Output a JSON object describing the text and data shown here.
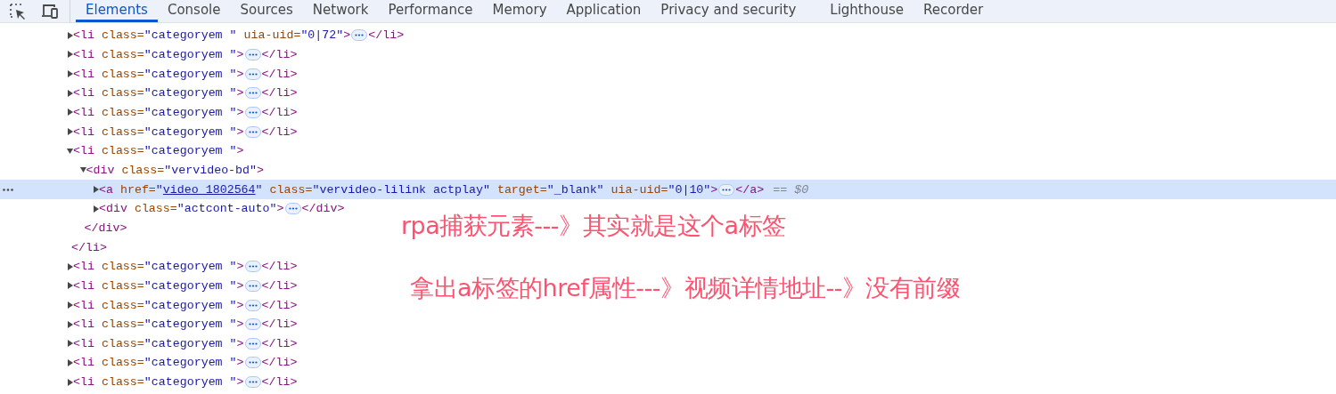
{
  "tabs": [
    {
      "label": "Elements",
      "selected": true
    },
    {
      "label": "Console",
      "selected": false
    },
    {
      "label": "Sources",
      "selected": false
    },
    {
      "label": "Network",
      "selected": false
    },
    {
      "label": "Performance",
      "selected": false
    },
    {
      "label": "Memory",
      "selected": false
    },
    {
      "label": "Application",
      "selected": false
    },
    {
      "label": "Privacy and security",
      "selected": false
    },
    {
      "label": "Lighthouse",
      "selected": false
    },
    {
      "label": "Recorder",
      "selected": false
    }
  ],
  "dom_tree": [
    {
      "expanded": false,
      "selected": false,
      "open": [
        {
          "kind": "tag",
          "text": "<li "
        },
        {
          "kind": "attr",
          "text": "class="
        },
        {
          "kind": "value",
          "text": "\"categoryem \""
        },
        {
          "kind": "attr",
          "text": " uia-uid="
        },
        {
          "kind": "value",
          "text": "\"0|72\""
        },
        {
          "kind": "tag",
          "text": ">"
        }
      ],
      "close": [
        {
          "kind": "tag",
          "text": "</li>"
        }
      ]
    },
    {
      "expanded": false,
      "selected": false,
      "open": [
        {
          "kind": "tag",
          "text": "<li "
        },
        {
          "kind": "attr",
          "text": "class="
        },
        {
          "kind": "value",
          "text": "\"categoryem \""
        },
        {
          "kind": "tag",
          "text": ">"
        }
      ],
      "close": [
        {
          "kind": "tag",
          "text": "</li>"
        }
      ]
    },
    {
      "expanded": false,
      "selected": false,
      "open": [
        {
          "kind": "tag",
          "text": "<li "
        },
        {
          "kind": "attr",
          "text": "class="
        },
        {
          "kind": "value",
          "text": "\"categoryem \""
        },
        {
          "kind": "tag",
          "text": ">"
        }
      ],
      "close": [
        {
          "kind": "tag",
          "text": "</li>"
        }
      ]
    },
    {
      "expanded": false,
      "selected": false,
      "open": [
        {
          "kind": "tag",
          "text": "<li "
        },
        {
          "kind": "attr",
          "text": "class="
        },
        {
          "kind": "value",
          "text": "\"categoryem \""
        },
        {
          "kind": "tag",
          "text": ">"
        }
      ],
      "close": [
        {
          "kind": "tag",
          "text": "</li>"
        }
      ]
    },
    {
      "expanded": false,
      "selected": false,
      "open": [
        {
          "kind": "tag",
          "text": "<li "
        },
        {
          "kind": "attr",
          "text": "class="
        },
        {
          "kind": "value",
          "text": "\"categoryem \""
        },
        {
          "kind": "tag",
          "text": ">"
        }
      ],
      "close": [
        {
          "kind": "tag",
          "text": "</li>"
        }
      ]
    },
    {
      "expanded": false,
      "selected": false,
      "open": [
        {
          "kind": "tag",
          "text": "<li "
        },
        {
          "kind": "attr",
          "text": "class="
        },
        {
          "kind": "value",
          "text": "\"categoryem \""
        },
        {
          "kind": "tag",
          "text": ">"
        }
      ],
      "close": [
        {
          "kind": "tag",
          "text": "</li>"
        }
      ]
    },
    {
      "expanded": true,
      "selected": false,
      "open": [
        {
          "kind": "tag",
          "text": "<li "
        },
        {
          "kind": "attr",
          "text": "class="
        },
        {
          "kind": "value",
          "text": "\"categoryem \""
        },
        {
          "kind": "tag",
          "text": ">"
        }
      ],
      "close": [
        {
          "kind": "tag",
          "text": "</li>"
        }
      ],
      "children": [
        {
          "expanded": true,
          "selected": false,
          "open": [
            {
              "kind": "tag",
              "text": "<div "
            },
            {
              "kind": "attr",
              "text": "class="
            },
            {
              "kind": "value",
              "text": "\"vervideo-bd\""
            },
            {
              "kind": "tag",
              "text": ">"
            }
          ],
          "close": [
            {
              "kind": "tag",
              "text": "</div>"
            }
          ],
          "children": [
            {
              "expanded": false,
              "selected": true,
              "open": [
                {
                  "kind": "tag",
                  "text": "<a "
                },
                {
                  "kind": "attr",
                  "text": "href="
                },
                {
                  "kind": "value",
                  "text": "\""
                },
                {
                  "kind": "link",
                  "text": "video_1802564"
                },
                {
                  "kind": "value",
                  "text": "\""
                },
                {
                  "kind": "attr",
                  "text": " class="
                },
                {
                  "kind": "value",
                  "text": "\"vervideo-lilink actplay\""
                },
                {
                  "kind": "attr",
                  "text": " target="
                },
                {
                  "kind": "value",
                  "text": "\"_blank\""
                },
                {
                  "kind": "attr",
                  "text": " uia-uid="
                },
                {
                  "kind": "value",
                  "text": "\"0|10\""
                },
                {
                  "kind": "tag",
                  "text": ">"
                }
              ],
              "close": [
                {
                  "kind": "tag",
                  "text": "</a>"
                }
              ],
              "console_ref": "== $0"
            },
            {
              "expanded": false,
              "selected": false,
              "open": [
                {
                  "kind": "tag",
                  "text": "<div "
                },
                {
                  "kind": "attr",
                  "text": "class="
                },
                {
                  "kind": "value",
                  "text": "\"actcont-auto\""
                },
                {
                  "kind": "tag",
                  "text": ">"
                }
              ],
              "close": [
                {
                  "kind": "tag",
                  "text": "</div>"
                }
              ]
            }
          ]
        }
      ]
    },
    {
      "expanded": false,
      "selected": false,
      "open": [
        {
          "kind": "tag",
          "text": "<li "
        },
        {
          "kind": "attr",
          "text": "class="
        },
        {
          "kind": "value",
          "text": "\"categoryem \""
        },
        {
          "kind": "tag",
          "text": ">"
        }
      ],
      "close": [
        {
          "kind": "tag",
          "text": "</li>"
        }
      ]
    },
    {
      "expanded": false,
      "selected": false,
      "open": [
        {
          "kind": "tag",
          "text": "<li "
        },
        {
          "kind": "attr",
          "text": "class="
        },
        {
          "kind": "value",
          "text": "\"categoryem \""
        },
        {
          "kind": "tag",
          "text": ">"
        }
      ],
      "close": [
        {
          "kind": "tag",
          "text": "</li>"
        }
      ]
    },
    {
      "expanded": false,
      "selected": false,
      "open": [
        {
          "kind": "tag",
          "text": "<li "
        },
        {
          "kind": "attr",
          "text": "class="
        },
        {
          "kind": "value",
          "text": "\"categoryem \""
        },
        {
          "kind": "tag",
          "text": ">"
        }
      ],
      "close": [
        {
          "kind": "tag",
          "text": "</li>"
        }
      ]
    },
    {
      "expanded": false,
      "selected": false,
      "open": [
        {
          "kind": "tag",
          "text": "<li "
        },
        {
          "kind": "attr",
          "text": "class="
        },
        {
          "kind": "value",
          "text": "\"categoryem \""
        },
        {
          "kind": "tag",
          "text": ">"
        }
      ],
      "close": [
        {
          "kind": "tag",
          "text": "</li>"
        }
      ]
    },
    {
      "expanded": false,
      "selected": false,
      "open": [
        {
          "kind": "tag",
          "text": "<li "
        },
        {
          "kind": "attr",
          "text": "class="
        },
        {
          "kind": "value",
          "text": "\"categoryem \""
        },
        {
          "kind": "tag",
          "text": ">"
        }
      ],
      "close": [
        {
          "kind": "tag",
          "text": "</li>"
        }
      ]
    },
    {
      "expanded": false,
      "selected": false,
      "open": [
        {
          "kind": "tag",
          "text": "<li "
        },
        {
          "kind": "attr",
          "text": "class="
        },
        {
          "kind": "value",
          "text": "\"categoryem \""
        },
        {
          "kind": "tag",
          "text": ">"
        }
      ],
      "close": [
        {
          "kind": "tag",
          "text": "</li>"
        }
      ]
    },
    {
      "expanded": false,
      "selected": false,
      "open": [
        {
          "kind": "tag",
          "text": "<li "
        },
        {
          "kind": "attr",
          "text": "class="
        },
        {
          "kind": "value",
          "text": "\"categoryem \""
        },
        {
          "kind": "tag",
          "text": ">"
        }
      ],
      "close": [
        {
          "kind": "tag",
          "text": "</li>"
        }
      ]
    }
  ],
  "annotations": [
    "rpa捕获元素---》其实就是这个a标签",
    "拿出a标签的href属性---》视频详情地址--》没有前缀"
  ]
}
